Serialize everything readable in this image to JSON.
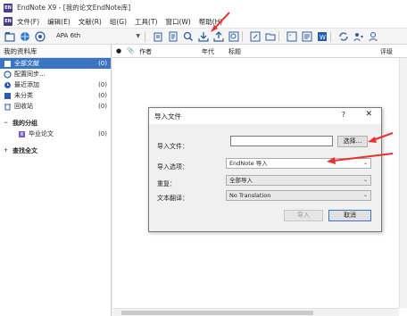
{
  "window": {
    "title": "EndNote X9 - [我的论文EndNote库]",
    "icon_text": "EN"
  },
  "menu": {
    "items": [
      "文件(F)",
      "编辑(E)",
      "文献(R)",
      "组(G)",
      "工具(T)",
      "窗口(W)",
      "帮助(H)"
    ]
  },
  "toolbar": {
    "style": "APA 6th",
    "icons": [
      "library-icon",
      "online-search-icon",
      "integrated-icon",
      "new-reference-icon",
      "open-reference-icon",
      "find-fulltext-icon",
      "import-icon",
      "export-icon",
      "online-find-icon",
      "open-link-icon",
      "open-file-icon",
      "insert-citation-icon",
      "format-bibliography-icon",
      "word-icon",
      "sync-icon",
      "share-icon",
      "user-icon"
    ]
  },
  "sidebar": {
    "header": "我的资料库",
    "items": [
      {
        "label": "全部文献",
        "count": "(0)",
        "icon": "all-refs-icon",
        "selected": true
      },
      {
        "label": "配置同步...",
        "count": "",
        "icon": "sync-config-icon",
        "selected": false
      },
      {
        "label": "最近添加",
        "count": "(0)",
        "icon": "recent-icon",
        "selected": false
      },
      {
        "label": "未分类",
        "count": "(0)",
        "icon": "unfiled-icon",
        "selected": false
      },
      {
        "label": "回收站",
        "count": "(0)",
        "icon": "trash-icon",
        "selected": false
      }
    ],
    "groups_title": "我的分组",
    "group_items": [
      {
        "label": "毕业论文",
        "count": "(0)"
      }
    ],
    "search_title": "查找全文"
  },
  "reflist": {
    "columns": [
      "作者",
      "年代",
      "标题",
      "评级"
    ]
  },
  "dialog": {
    "title": "导入文件",
    "help": "?",
    "close": "✕",
    "file_label": "导入文件：",
    "file_value": "",
    "choose_button": "选择...",
    "option_label": "导入选项：",
    "option_value": "EndNote 导入",
    "duplicates_label": "重复：",
    "duplicates_value": "全部导入",
    "translation_label": "文本翻译：",
    "translation_value": "No Translation",
    "import_button": "导入",
    "cancel_button": "取消"
  },
  "colors": {
    "selection": "#3a75c4",
    "arrow": "#e8312a"
  }
}
